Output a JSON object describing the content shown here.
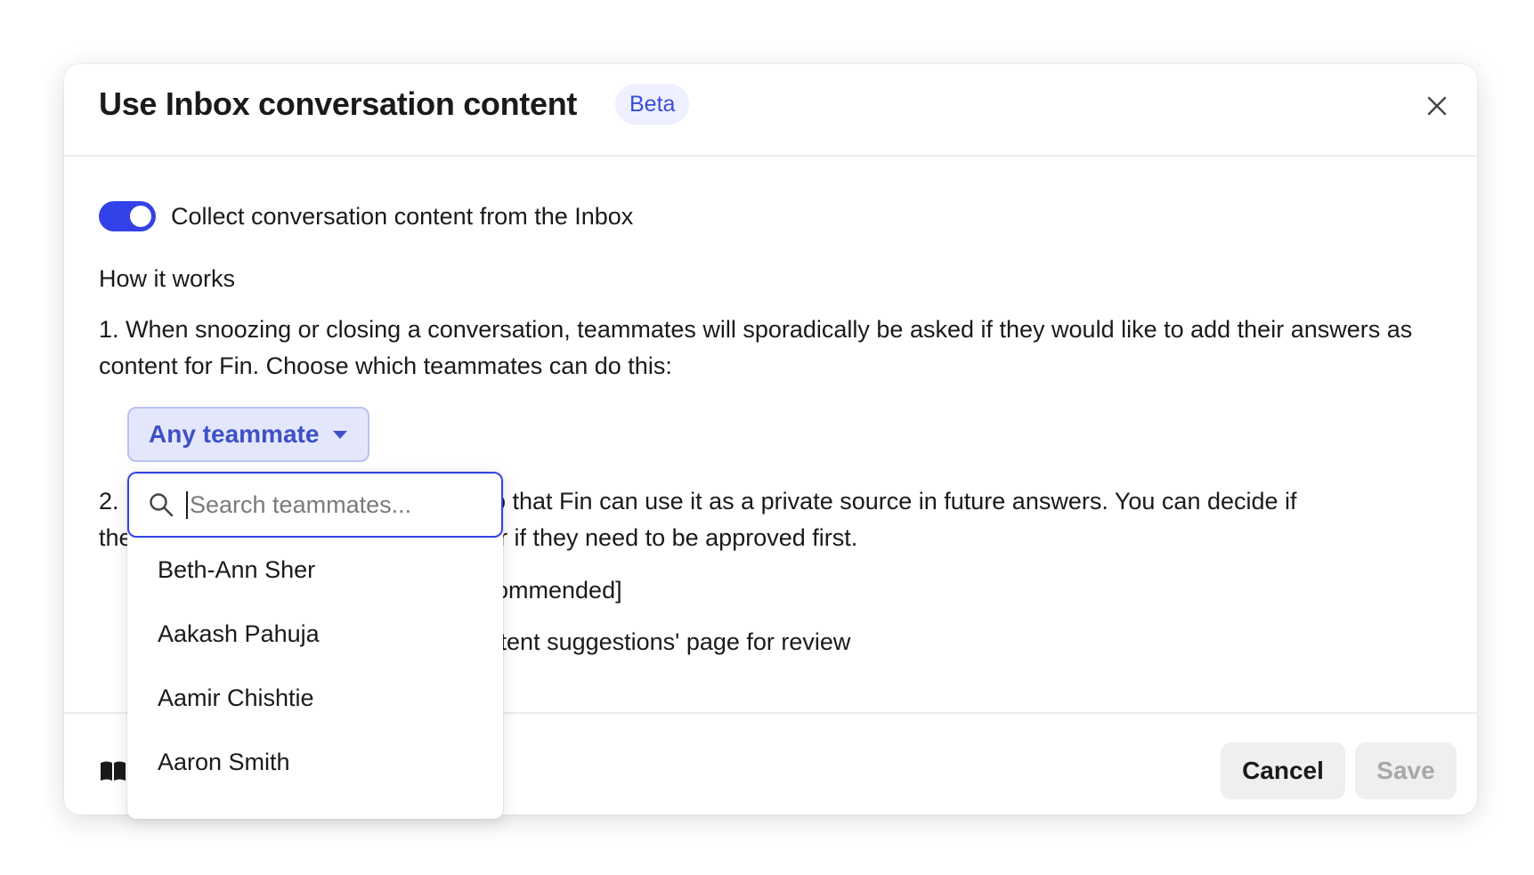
{
  "modal": {
    "title": "Use Inbox conversation content",
    "badge": "Beta"
  },
  "toggle": {
    "label": "Collect conversation content from the Inbox",
    "enabled": true,
    "color": "#3342e8"
  },
  "section": {
    "heading": "How it works",
    "step1": "1. When snoozing or closing a conversation, teammates will sporadically be asked if they would like to add their answers as content for Fin. Choose which teammates can do this:",
    "step2_visible_start": "2.",
    "step2_visible_line1_rest": "ts’ so that Fin can use it as a private source in future answers. You can decide if",
    "step2_visible_line2_start": "the",
    "step2_visible_line2_rest": "or if they need to be approved first.",
    "option1_visible": "Recommended]",
    "option2_visible": "Content suggestions' page for review"
  },
  "teammate_select": {
    "selected": "Any teammate",
    "search_placeholder": "Search teammates...",
    "teammates": [
      "Beth-Ann Sher",
      "Aakash Pahuja",
      "Aamir Chishtie",
      "Aaron Smith"
    ]
  },
  "footer": {
    "cancel_label": "Cancel",
    "save_label": "Save",
    "help_icon": "book-icon"
  },
  "colors": {
    "accent": "#3342e8",
    "badge_bg": "#eef0ff",
    "badge_text": "#3a4fd6",
    "dropdown_bg": "#e4e7fb"
  }
}
